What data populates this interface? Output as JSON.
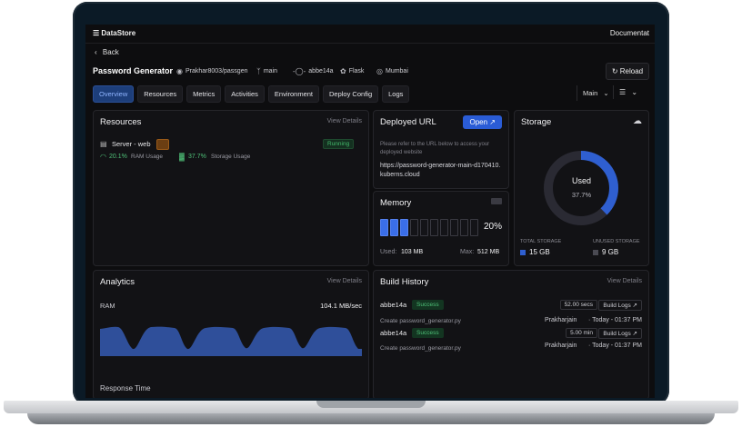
{
  "topbar": {
    "brand": "DataStore",
    "docs": "Documentat"
  },
  "nav": {
    "back": "Back"
  },
  "project": {
    "title": "Password Generator",
    "repo": "Prakhar8003/passgen",
    "branch": "main",
    "commit": "abbe14a",
    "framework": "Flask",
    "region": "Mumbai",
    "reload": "Reload"
  },
  "tabs": [
    "Overview",
    "Resources",
    "Metrics",
    "Activities",
    "Environment",
    "Deploy Config",
    "Logs"
  ],
  "branch_select": "Main",
  "resources": {
    "title": "Resources",
    "view": "View Details",
    "server": "Server - web",
    "status": "Running",
    "ram_pct": "20.1%",
    "ram_label": "RAM Usage",
    "storage_pct": "37.7%",
    "storage_label": "Storage Usage"
  },
  "deployed": {
    "title": "Deployed URL",
    "open": "Open",
    "hint": "Please refer to the URL below to access your deployed website",
    "url": "https://password-generator-main-d170410.kuberns.cloud"
  },
  "storage": {
    "title": "Storage",
    "used_label": "Used",
    "used_pct": "37.7%",
    "used_fraction": 0.377,
    "total_label": "TOTAL STORAGE",
    "total": "15 GB",
    "unused_label": "UNUSED STORAGE",
    "unused": "9 GB"
  },
  "memory": {
    "title": "Memory",
    "pct": "20%",
    "level": 0.2,
    "cells_on": 3,
    "cells_total": 10,
    "used_label": "Used:",
    "used": "103 MB",
    "max_label": "Max:",
    "max": "512 MB"
  },
  "analytics": {
    "title": "Analytics",
    "view": "View Details",
    "ram_label": "RAM",
    "ram_value": "104.1 MB/sec",
    "response_label": "Response Time"
  },
  "builds": {
    "title": "Build History",
    "view": "View Details",
    "items": [
      {
        "commit": "abbe14a",
        "status": "Success",
        "duration": "52.00 secs",
        "logs": "Build Logs",
        "message": "Create password_generator.py",
        "author": "Prakharjain",
        "time": "· Today - 01:37 PM"
      },
      {
        "commit": "abbe14a",
        "status": "Success",
        "duration": "5.00 min",
        "logs": "Build Logs",
        "message": "Create password_generator.py",
        "author": "Prakharjain",
        "time": "· Today - 01:37 PM"
      }
    ]
  },
  "colors": {
    "accent": "#2a5cd6",
    "success": "#43b96b",
    "chart": "#2f4f9a"
  }
}
